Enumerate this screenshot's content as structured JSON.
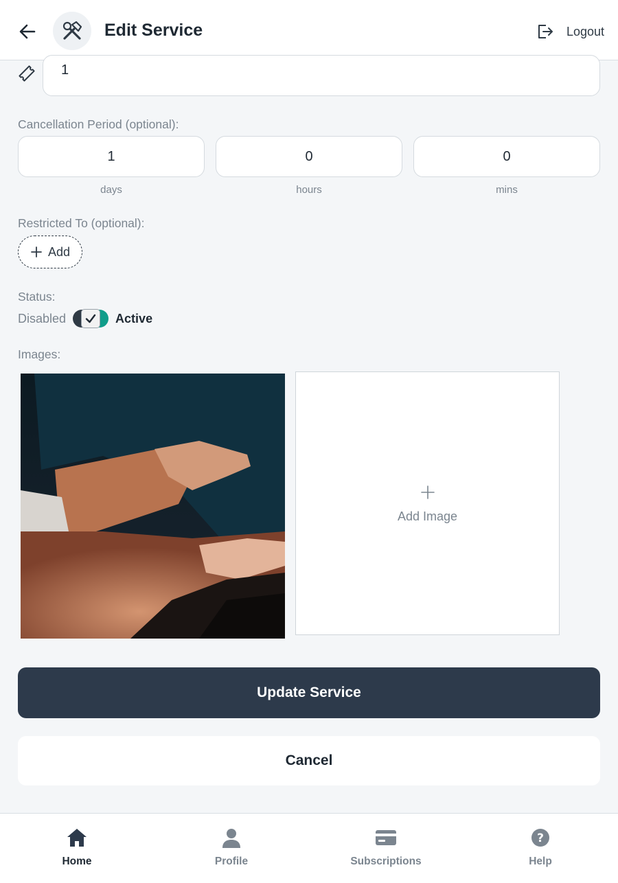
{
  "header": {
    "title": "Edit Service",
    "logout_label": "Logout"
  },
  "top_field": {
    "value": "1"
  },
  "cancellation": {
    "label": "Cancellation Period (optional):",
    "days_value": "1",
    "hours_value": "0",
    "mins_value": "0",
    "days_unit": "days",
    "hours_unit": "hours",
    "mins_unit": "mins"
  },
  "restricted": {
    "label": "Restricted To (optional):",
    "add_label": "Add"
  },
  "status": {
    "label": "Status:",
    "disabled_label": "Disabled",
    "active_label": "Active",
    "is_active": true
  },
  "images": {
    "label": "Images:",
    "add_image_label": "Add Image"
  },
  "actions": {
    "update_label": "Update Service",
    "cancel_label": "Cancel"
  },
  "nav": {
    "items": [
      {
        "label": "Home",
        "icon": "home-icon",
        "active": true
      },
      {
        "label": "Profile",
        "icon": "person-icon",
        "active": false
      },
      {
        "label": "Subscriptions",
        "icon": "card-icon",
        "active": false
      },
      {
        "label": "Help",
        "icon": "help-icon",
        "active": false
      }
    ]
  },
  "colors": {
    "primary": "#2d3a4b",
    "toggle_on": "#0f9d8a",
    "background": "#f4f6f8",
    "muted_text": "#7b858f"
  }
}
